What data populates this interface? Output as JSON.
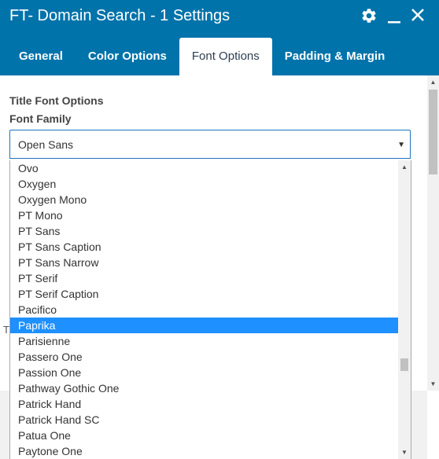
{
  "window": {
    "title": "FT- Domain Search - 1 Settings"
  },
  "tabs": [
    {
      "label": "General"
    },
    {
      "label": "Color Options"
    },
    {
      "label": "Font Options"
    },
    {
      "label": "Padding & Margin"
    }
  ],
  "section": {
    "title": "Title Font Options",
    "field_label": "Font Family"
  },
  "select": {
    "value": "Open Sans"
  },
  "dropdown": {
    "options": [
      "Ovo",
      "Oxygen",
      "Oxygen Mono",
      "PT Mono",
      "PT Sans",
      "PT Sans Caption",
      "PT Sans Narrow",
      "PT Serif",
      "PT Serif Caption",
      "Pacifico",
      "Paprika",
      "Parisienne",
      "Passero One",
      "Passion One",
      "Pathway Gothic One",
      "Patrick Hand",
      "Patrick Hand SC",
      "Patua One",
      "Paytone One"
    ],
    "selected": "Paprika"
  },
  "partial_label": "T",
  "colors": {
    "accent": "#0073aa",
    "highlight": "#1e90ff"
  },
  "icons": {
    "settings": "gear-icon",
    "minimize": "minimize-icon",
    "close": "close-icon"
  }
}
